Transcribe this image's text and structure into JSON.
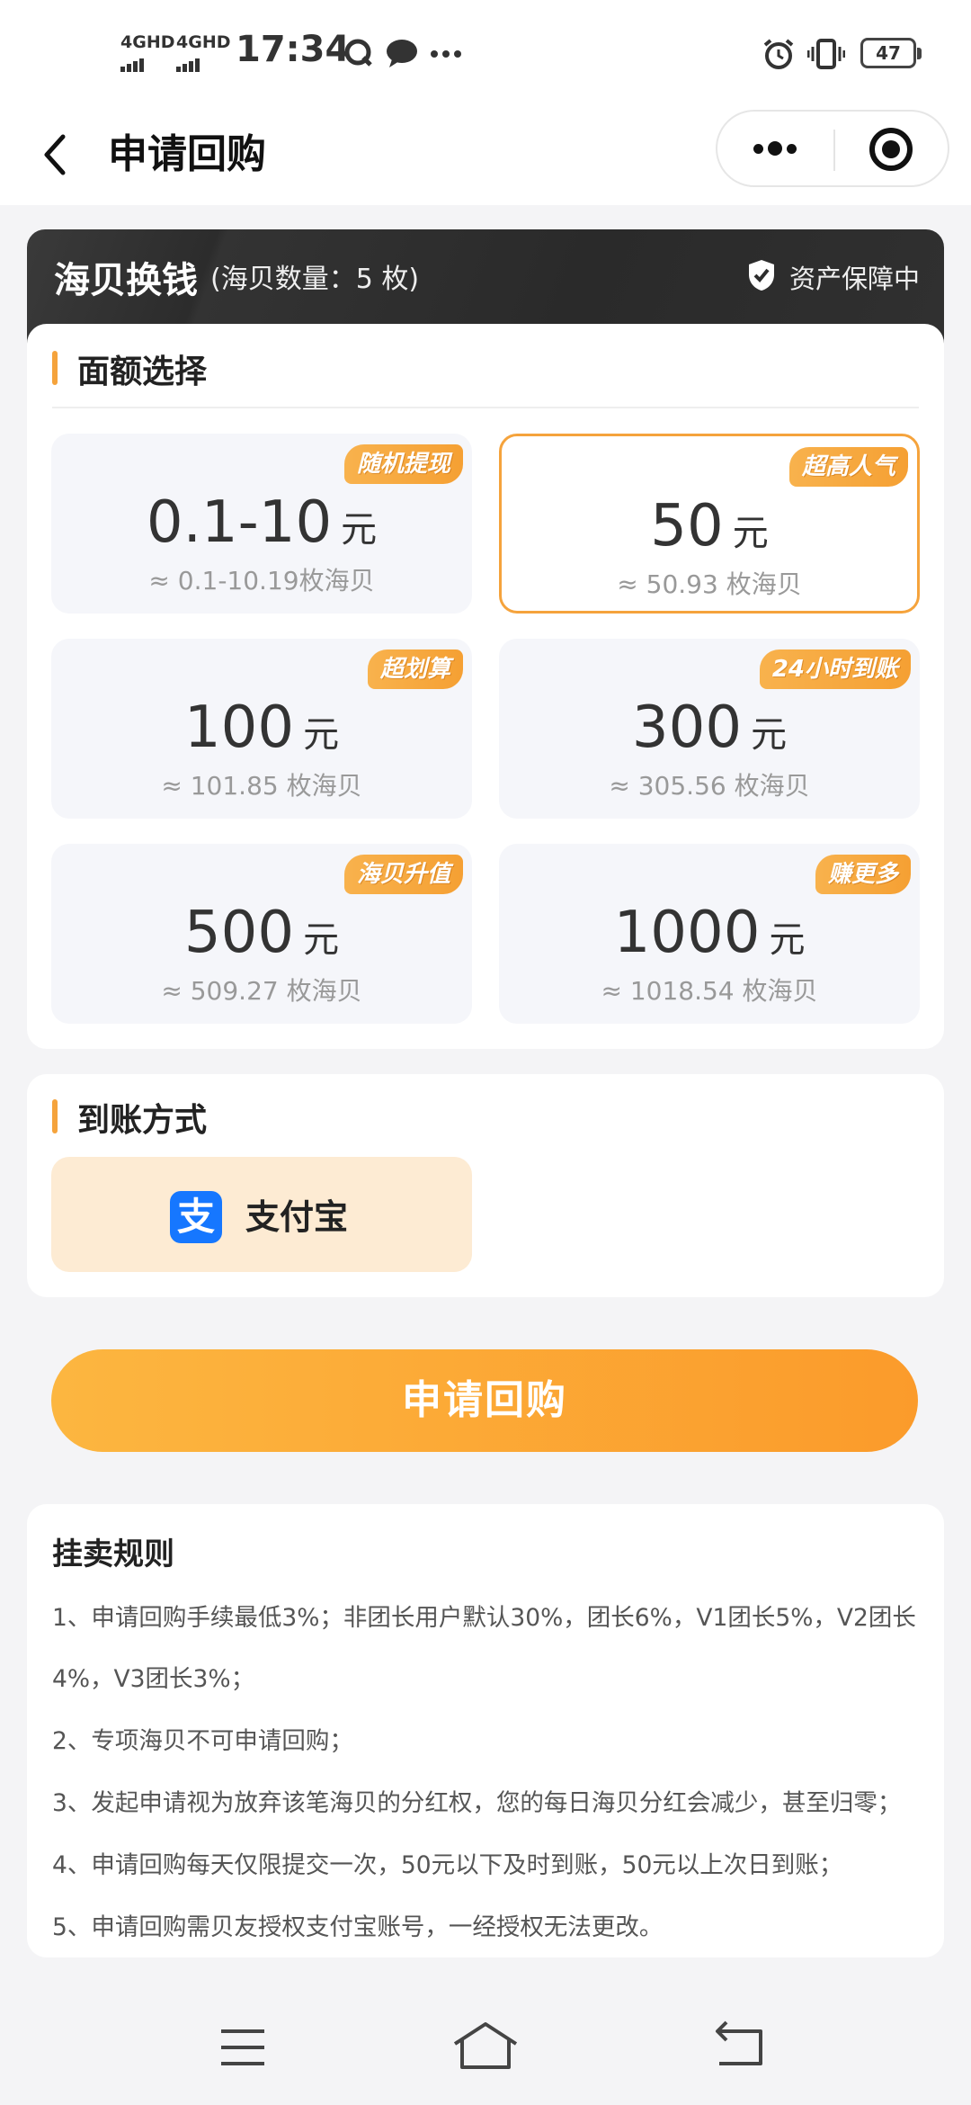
{
  "status_bar": {
    "network1": "4GHD",
    "network2": "4GHD",
    "time": "17:34",
    "battery": "47"
  },
  "header": {
    "title": "申请回购"
  },
  "exchange": {
    "title": "海贝换钱",
    "count_text": "(海贝数量：5 枚)",
    "protect_text": "资产保障中"
  },
  "amount_section": {
    "title": "面额选择",
    "tiles": [
      {
        "tag": "随机提现",
        "amount": "0.1-10",
        "unit": "元",
        "sub": "≈ 0.1-10.19枚海贝"
      },
      {
        "tag": "超高人气",
        "amount": "50",
        "unit": "元",
        "sub": "≈ 50.93 枚海贝"
      },
      {
        "tag": "超划算",
        "amount": "100",
        "unit": "元",
        "sub": "≈ 101.85 枚海贝"
      },
      {
        "tag": "24小时到账",
        "amount": "300",
        "unit": "元",
        "sub": "≈ 305.56 枚海贝"
      },
      {
        "tag": "海贝升值",
        "amount": "500",
        "unit": "元",
        "sub": "≈ 509.27 枚海贝"
      },
      {
        "tag": "赚更多",
        "amount": "1000",
        "unit": "元",
        "sub": "≈ 1018.54 枚海贝"
      }
    ]
  },
  "payment_section": {
    "title": "到账方式",
    "alipay_icon_char": "支",
    "alipay_label": "支付宝"
  },
  "submit_label": "申请回购",
  "rules": {
    "title": "挂卖规则",
    "items": [
      "1、申请回购手续最低3%；非团长用户默认30%，团长6%，V1团长5%，V2团长",
      "4%，V3团长3%；",
      "2、专项海贝不可申请回购；",
      "3、发起申请视为放弃该笔海贝的分红权，您的每日海贝分红会减少，甚至归零；",
      "4、申请回购每天仅限提交一次，50元以下及时到账，50元以上次日到账；",
      "5、申请回购需贝友授权支付宝账号，一经授权无法更改。"
    ]
  },
  "colors": {
    "accent": "#f5a33c",
    "alipay": "#1677ff",
    "dark_header": "#2c2c2c"
  }
}
